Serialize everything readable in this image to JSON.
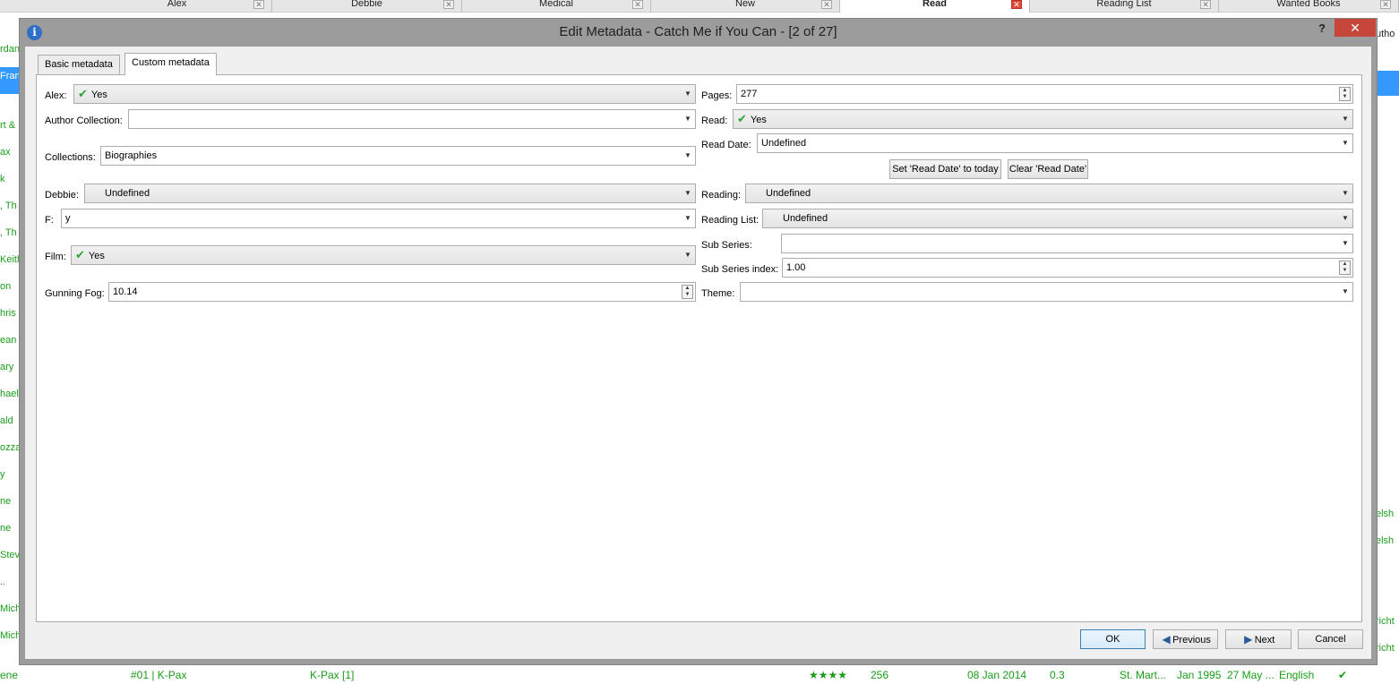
{
  "background": {
    "tabs": [
      {
        "label": "Alex",
        "active": false
      },
      {
        "label": "Debbie",
        "active": false
      },
      {
        "label": "Medical",
        "active": false
      },
      {
        "label": "New",
        "active": false
      },
      {
        "label": "Read",
        "active": true
      },
      {
        "label": "Reading List",
        "active": false
      },
      {
        "label": "Wanted Books",
        "active": false
      }
    ],
    "left_rows": [
      "rdan",
      "Fran",
      "rt &",
      "ax",
      "k",
      ", Th",
      ", Th",
      "Keith",
      "on",
      "hris",
      "ean",
      "ary",
      "hael",
      "ald",
      "ozza",
      "y",
      "ne",
      "ne",
      "Stev",
      "..",
      "Mich",
      "Mich"
    ],
    "right_rows": [
      "utho",
      "elsh",
      "elsh",
      "richt",
      "richt"
    ],
    "bottom_row": {
      "author": "ene",
      "series_index": "#01 | K-Pax",
      "series": "K-Pax [1]",
      "rating": "★★★★",
      "pages": "256",
      "date": "08 Jan 2014",
      "gunning_fog": "0.3",
      "publisher": "St. Mart...",
      "published": "Jan 1995",
      "modified": "27 May ...",
      "language": "English",
      "read_mark": "✔"
    }
  },
  "dialog": {
    "title": "Edit Metadata - Catch Me if You Can -  [2 of 27]",
    "help_label": "?",
    "close_label": "✕",
    "tabs": {
      "basic": "Basic metadata",
      "custom": "Custom metadata"
    },
    "left": {
      "alex": {
        "label": "Alex:",
        "value": "Yes"
      },
      "author_collection": {
        "label": "Author Collection:",
        "value": ""
      },
      "collections": {
        "label": "Collections:",
        "value": "Biographies"
      },
      "debbie": {
        "label": "Debbie:",
        "value": "Undefined"
      },
      "f": {
        "label": "F:",
        "value": "y"
      },
      "film": {
        "label": "Film:",
        "value": "Yes"
      },
      "gunning_fog": {
        "label": "Gunning Fog:",
        "value": "10.14"
      }
    },
    "right": {
      "pages": {
        "label": "Pages:",
        "value": "277"
      },
      "read": {
        "label": "Read:",
        "value": "Yes"
      },
      "read_date": {
        "label": "Read Date:",
        "value": "Undefined"
      },
      "set_read_date": "Set 'Read Date' to today",
      "clear_read_date": "Clear 'Read Date'",
      "reading": {
        "label": "Reading:",
        "value": "Undefined"
      },
      "reading_list": {
        "label": "Reading List:",
        "value": "Undefined"
      },
      "sub_series": {
        "label": "Sub Series:",
        "value": ""
      },
      "sub_series_index": {
        "label": "Sub Series index:",
        "value": "1.00"
      },
      "theme": {
        "label": "Theme:",
        "value": ""
      }
    },
    "buttons": {
      "ok": "OK",
      "previous": "Previous",
      "next": "Next",
      "cancel": "Cancel"
    }
  }
}
